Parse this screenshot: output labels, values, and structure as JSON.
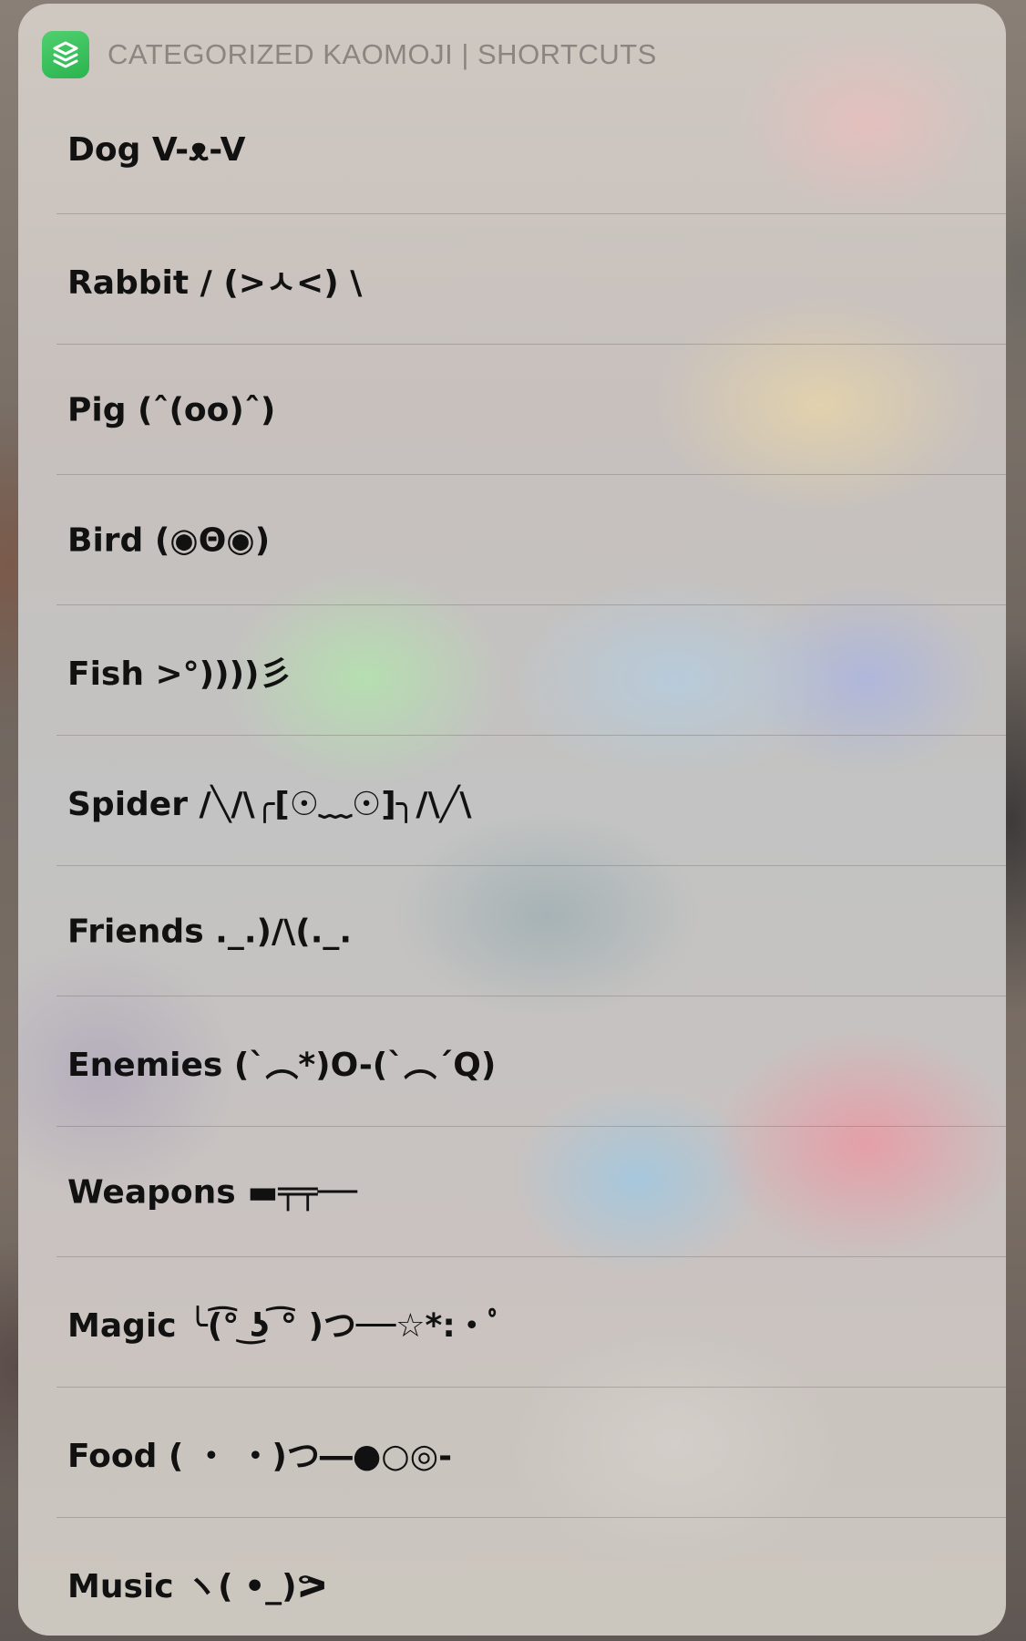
{
  "app": {
    "title": "CATEGORIZED KAOMOJI | SHORTCUTS",
    "icon": "shortcuts-icon",
    "accent_color": "#34C759"
  },
  "items": [
    {
      "label": "Dog V-ᴥ-V"
    },
    {
      "label": "Rabbit  / (>ㅅ<) \\"
    },
    {
      "label": "Pig (ˆ(oo)ˆ)"
    },
    {
      "label": "Bird (◉Θ◉)"
    },
    {
      "label": "Fish >°))))彡"
    },
    {
      "label": "Spider /╲/\\╭[☉﹏☉]╮/\\╱\\"
    },
    {
      "label": "Friends ._.)/\\(._."
    },
    {
      "label": "Enemies (`︵*)O-(`︵´Q)"
    },
    {
      "label": "Weapons ▬╤╤──"
    },
    {
      "label": "Magic  ╰(͡° ͜ʖ ͡° )つ──☆*:・ﾟ"
    },
    {
      "label": "Food ( ・ ・)つ―●○◎-"
    },
    {
      "label": "Music ヽ( •_)ᕗ"
    }
  ]
}
